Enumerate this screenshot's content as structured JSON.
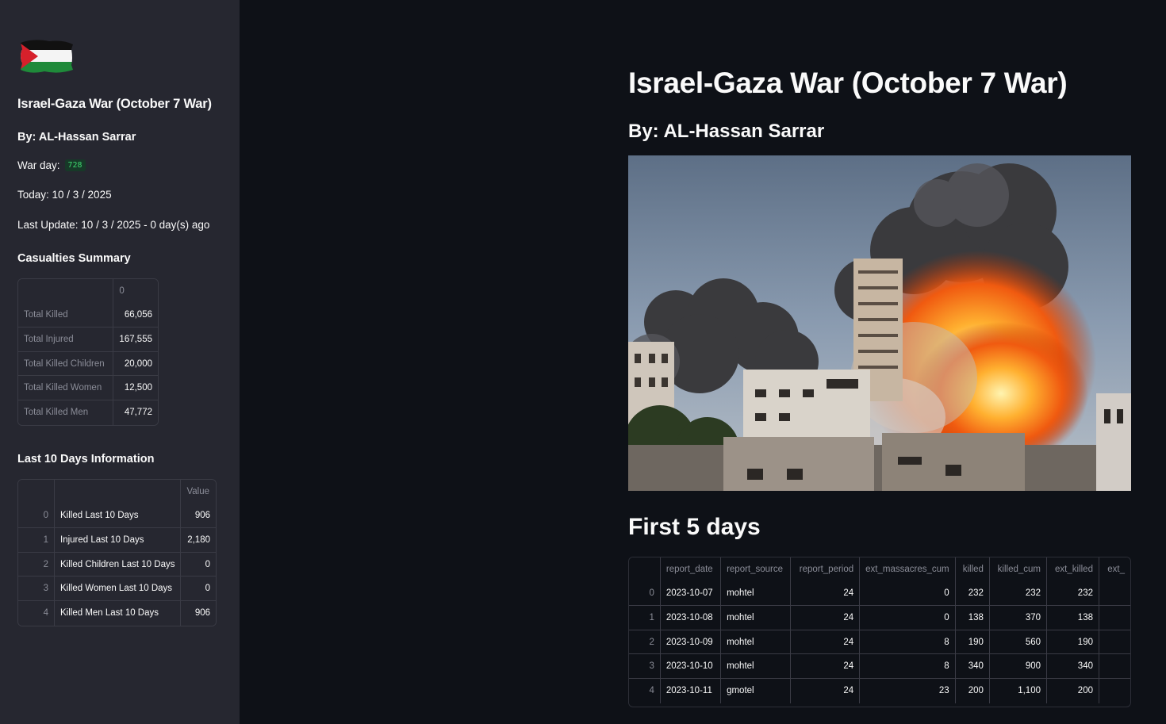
{
  "sidebar": {
    "title": "Israel-Gaza War (October 7 War)",
    "author": "By: AL-Hassan Sarrar",
    "war_day_label": "War day:",
    "war_day_value": "728",
    "today": "Today: 10 / 3 / 2025",
    "last_update": "Last Update: 10 / 3 / 2025 - 0 day(s) ago",
    "casualties_heading": "Casualties Summary",
    "casualties_table": {
      "column": "0",
      "rows": [
        {
          "label": "Total Killed",
          "value": "66,056"
        },
        {
          "label": "Total Injured",
          "value": "167,555"
        },
        {
          "label": "Total Killed Children",
          "value": "20,000"
        },
        {
          "label": "Total Killed Women",
          "value": "12,500"
        },
        {
          "label": "Total Killed Men",
          "value": "47,772"
        }
      ]
    },
    "last10_heading": "Last 10 Days Information",
    "last10_table": {
      "column": "Value",
      "rows": [
        {
          "idx": "0",
          "label": "Killed Last 10 Days",
          "value": "906"
        },
        {
          "idx": "1",
          "label": "Injured Last 10 Days",
          "value": "2,180"
        },
        {
          "idx": "2",
          "label": "Killed Children Last 10 Days",
          "value": "0"
        },
        {
          "idx": "3",
          "label": "Killed Women Last 10 Days",
          "value": "0"
        },
        {
          "idx": "4",
          "label": "Killed Men Last 10 Days",
          "value": "906"
        }
      ]
    }
  },
  "main": {
    "title": "Israel-Gaza War (October 7 War)",
    "author": "By: AL-Hassan Sarrar",
    "first5_heading": "First 5 days",
    "first5_table": {
      "columns": [
        "report_date",
        "report_source",
        "report_period",
        "ext_massacres_cum",
        "killed",
        "killed_cum",
        "ext_killed",
        "ext_"
      ],
      "rows": [
        {
          "idx": "0",
          "report_date": "2023-10-07",
          "report_source": "mohtel",
          "report_period": "24",
          "ext_massacres_cum": "0",
          "killed": "232",
          "killed_cum": "232",
          "ext_killed": "232"
        },
        {
          "idx": "1",
          "report_date": "2023-10-08",
          "report_source": "mohtel",
          "report_period": "24",
          "ext_massacres_cum": "0",
          "killed": "138",
          "killed_cum": "370",
          "ext_killed": "138"
        },
        {
          "idx": "2",
          "report_date": "2023-10-09",
          "report_source": "mohtel",
          "report_period": "24",
          "ext_massacres_cum": "8",
          "killed": "190",
          "killed_cum": "560",
          "ext_killed": "190"
        },
        {
          "idx": "3",
          "report_date": "2023-10-10",
          "report_source": "mohtel",
          "report_period": "24",
          "ext_massacres_cum": "8",
          "killed": "340",
          "killed_cum": "900",
          "ext_killed": "340"
        },
        {
          "idx": "4",
          "report_date": "2023-10-11",
          "report_source": "gmotel",
          "report_period": "24",
          "ext_massacres_cum": "23",
          "killed": "200",
          "killed_cum": "1,100",
          "ext_killed": "200"
        }
      ]
    }
  },
  "colors": {
    "sidebar_bg": "#262730",
    "main_bg": "#0e1117",
    "badge_bg": "#173928",
    "badge_text": "#3dd56d"
  }
}
